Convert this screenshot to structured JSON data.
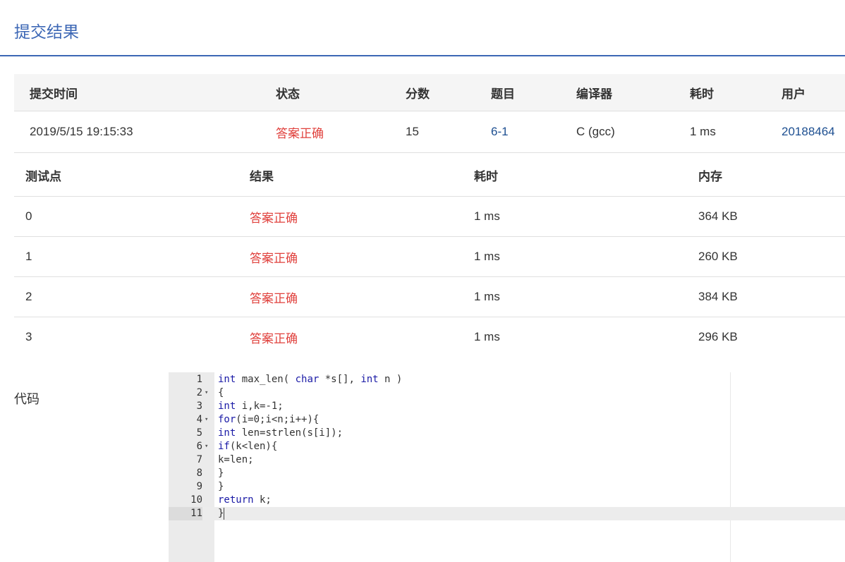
{
  "header": {
    "title": "提交结果"
  },
  "summary": {
    "columns": [
      "提交时间",
      "状态",
      "分数",
      "题目",
      "编译器",
      "耗时",
      "用户"
    ],
    "row": {
      "time": "2019/5/15 19:15:33",
      "status": "答案正确",
      "score": "15",
      "problem": "6-1",
      "compiler": "C (gcc)",
      "elapsed": "1 ms",
      "user": "20188464"
    }
  },
  "tests": {
    "columns": [
      "测试点",
      "结果",
      "耗时",
      "内存"
    ],
    "rows": [
      {
        "id": "0",
        "result": "答案正确",
        "time": "1 ms",
        "memory": "364 KB"
      },
      {
        "id": "1",
        "result": "答案正确",
        "time": "1 ms",
        "memory": "260 KB"
      },
      {
        "id": "2",
        "result": "答案正确",
        "time": "1 ms",
        "memory": "384 KB"
      },
      {
        "id": "3",
        "result": "答案正确",
        "time": "1 ms",
        "memory": "296 KB"
      }
    ]
  },
  "code": {
    "label": "代码",
    "lines": [
      {
        "n": "1",
        "fold": "",
        "tokens": [
          [
            "kw",
            "int"
          ],
          [
            "nm",
            " max_len( "
          ],
          [
            "kw",
            "char"
          ],
          [
            "nm",
            " *s[], "
          ],
          [
            "kw",
            "int"
          ],
          [
            "nm",
            " n )"
          ]
        ]
      },
      {
        "n": "2",
        "fold": "▾",
        "tokens": [
          [
            "nm",
            "{"
          ]
        ]
      },
      {
        "n": "3",
        "fold": "",
        "tokens": [
          [
            "kw",
            "int"
          ],
          [
            "nm",
            " i,k=-1;"
          ]
        ]
      },
      {
        "n": "4",
        "fold": "▾",
        "tokens": [
          [
            "kw",
            "for"
          ],
          [
            "nm",
            "(i=0;i<n;i++){"
          ]
        ]
      },
      {
        "n": "5",
        "fold": "",
        "tokens": [
          [
            "kw",
            "int"
          ],
          [
            "nm",
            " len=strlen(s[i]);"
          ]
        ]
      },
      {
        "n": "6",
        "fold": "▾",
        "tokens": [
          [
            "kw",
            "if"
          ],
          [
            "nm",
            "(k<len){"
          ]
        ]
      },
      {
        "n": "7",
        "fold": "",
        "tokens": [
          [
            "nm",
            "k=len;"
          ]
        ]
      },
      {
        "n": "8",
        "fold": "",
        "tokens": [
          [
            "nm",
            "}"
          ]
        ]
      },
      {
        "n": "9",
        "fold": "",
        "tokens": [
          [
            "nm",
            "}"
          ]
        ]
      },
      {
        "n": "10",
        "fold": "",
        "tokens": [
          [
            "kw",
            "return"
          ],
          [
            "nm",
            " k;"
          ]
        ]
      },
      {
        "n": "11",
        "fold": "",
        "tokens": [
          [
            "nm",
            "}"
          ]
        ]
      }
    ],
    "active_line": 11,
    "colors": {
      "keyword": "#1a1aa6",
      "text": "#333333",
      "accent": "#3c67b5",
      "success": "#e0413d",
      "link": "#1d4f91"
    }
  }
}
